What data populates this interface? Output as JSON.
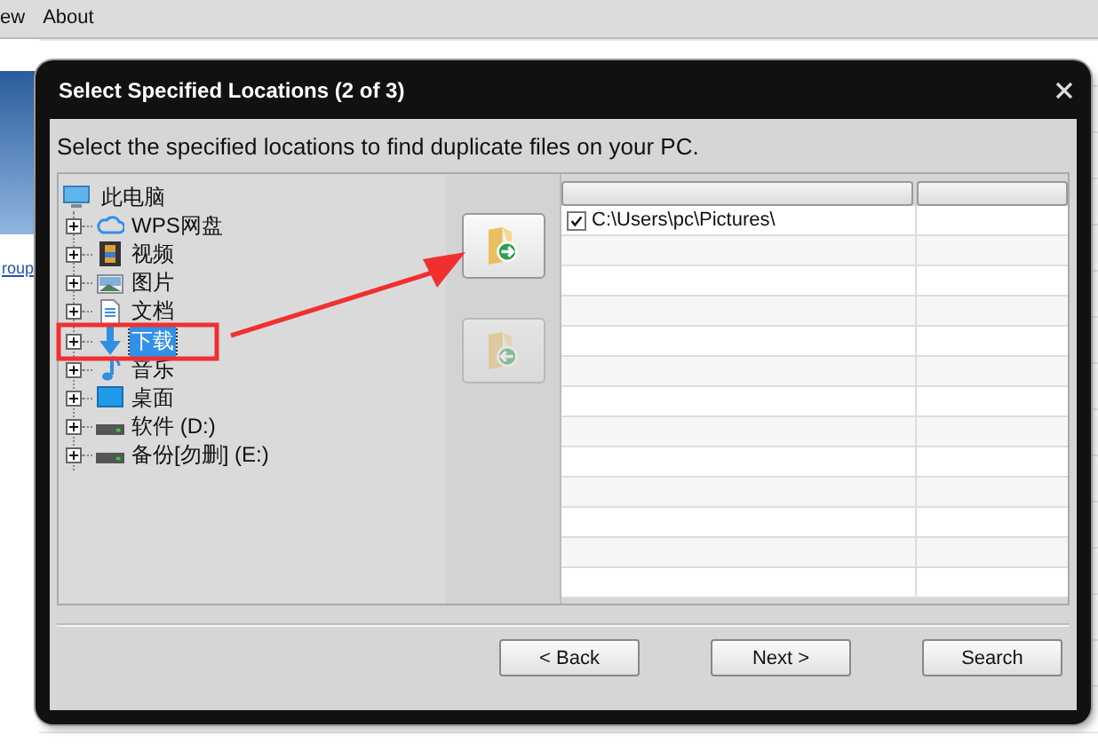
{
  "app": {
    "menu": [
      "ew",
      "About"
    ],
    "side_link": "roup"
  },
  "dialog": {
    "title": "Select Specified Locations (2 of 3)",
    "instruction": "Select the specified locations to find duplicate files on your PC.",
    "tree": {
      "label": "此电脑",
      "kind": "computer",
      "children": [
        {
          "label": "WPS网盘",
          "kind": "cloud",
          "selected": false
        },
        {
          "label": "视频",
          "kind": "video",
          "selected": false
        },
        {
          "label": "图片",
          "kind": "picture",
          "selected": false
        },
        {
          "label": "文档",
          "kind": "document",
          "selected": false
        },
        {
          "label": "下载",
          "kind": "download",
          "selected": true
        },
        {
          "label": "音乐",
          "kind": "music",
          "selected": false
        },
        {
          "label": "桌面",
          "kind": "desktop",
          "selected": false
        },
        {
          "label": "软件 (D:)",
          "kind": "drive",
          "selected": false
        },
        {
          "label": "备份[勿删] (E:)",
          "kind": "drive",
          "selected": false
        }
      ]
    },
    "add_button": {
      "disabled": false
    },
    "remove_button": {
      "disabled": true
    },
    "locations": [
      {
        "path": "C:\\Users\\pc\\Pictures\\",
        "checked": true
      }
    ],
    "buttons": [
      "< Back",
      "Next >",
      "Search"
    ]
  }
}
